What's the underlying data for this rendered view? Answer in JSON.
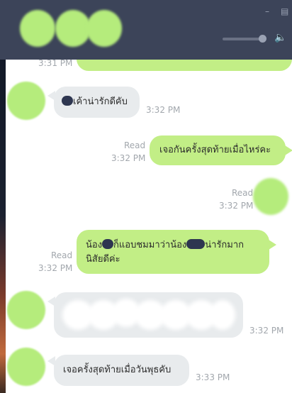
{
  "window": {
    "minimize_icon": "minimize-icon",
    "maximize_icon": "maximize-icon",
    "volume_icon": "speaker-icon",
    "volume_level": 0.8
  },
  "colors": {
    "titlebar": "#3c4459",
    "outgoing_bubble": "#c2ee86",
    "incoming_bubble": "#e8ebed",
    "avatar_blur": "#b5ec7c",
    "meta_text": "#a2a7ad"
  },
  "chat": {
    "prev_time": "3:31 PM",
    "msg1": {
      "text": "เค้าน่ารักดีคับ",
      "time": "3:32 PM"
    },
    "msg2": {
      "read": "Read",
      "time": "3:32 PM",
      "text": "เจอกันครั้งสุดท้ายเมื่อไหร่คะ"
    },
    "msg3": {
      "read": "Read",
      "time": "3:32 PM"
    },
    "msg4": {
      "read": "Read",
      "time": "3:32 PM",
      "line1_a": "น้อง",
      "line1_b": "ก็แอบชมมาว่าน้อง",
      "line1_c": "น่ารักมาก",
      "line2": "นิสัยดีค่ะ"
    },
    "msg5": {
      "time": "3:32 PM"
    },
    "msg6": {
      "text": "เจอครั้งสุดท้ายเมื่อวันพุธคับ",
      "time": "3:33 PM"
    }
  }
}
